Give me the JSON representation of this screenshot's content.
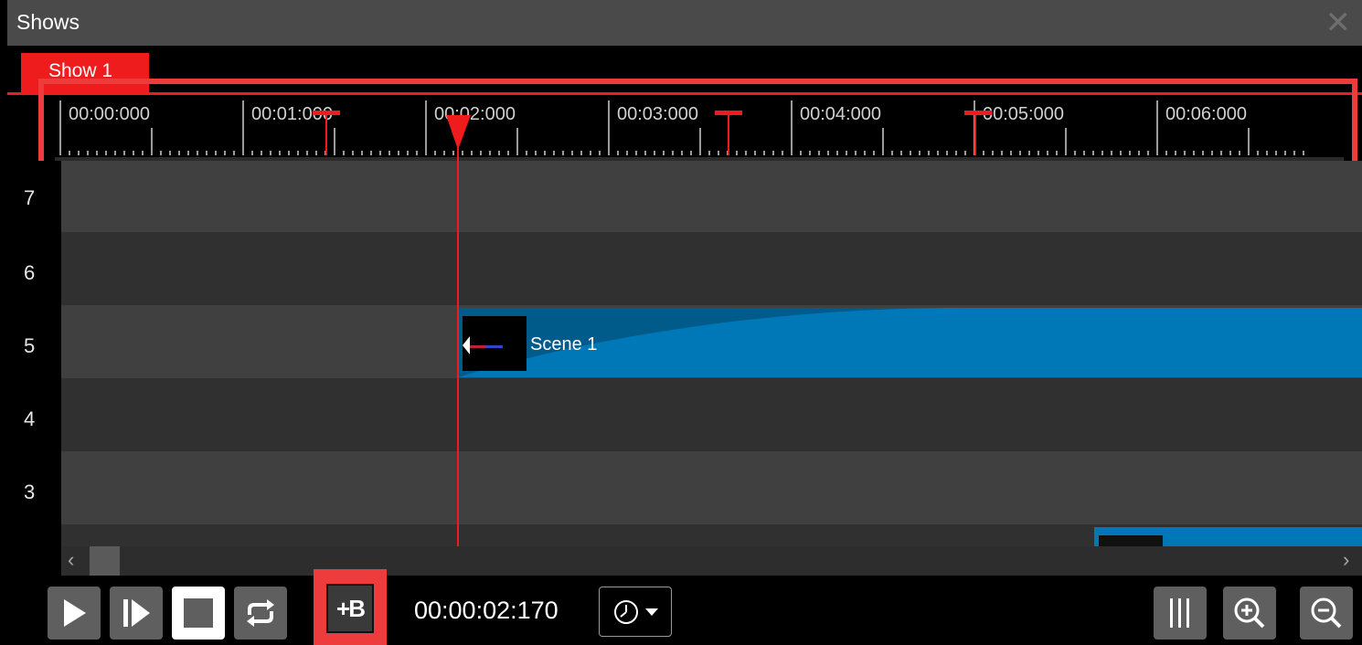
{
  "window": {
    "title": "Shows",
    "close_glyph": "✕"
  },
  "tabs": [
    {
      "label": "Show 1",
      "active": true
    }
  ],
  "ruler": {
    "labels": [
      "00:00:000",
      "00:01:000",
      "00:02:000",
      "00:03:000",
      "00:04:000",
      "00:05:000",
      "00:06:000"
    ]
  },
  "lanes": [
    {
      "label": "7"
    },
    {
      "label": "6"
    },
    {
      "label": "5"
    },
    {
      "label": "4"
    },
    {
      "label": "3"
    }
  ],
  "clips": [
    {
      "name": "Scene 1",
      "lane": "5"
    }
  ],
  "transport": {
    "timecode": "00:00:02:170",
    "bookmark_label": "+B"
  },
  "icons": {
    "play": "play-icon",
    "step": "step-forward-icon",
    "stop": "stop-icon",
    "loop": "loop-icon",
    "clock": "clock-icon",
    "columns": "columns-icon",
    "zoom_in": "zoom-in-icon",
    "zoom_out": "zoom-out-icon"
  },
  "colors": {
    "accent": "#ee1c1c",
    "clip": "#0077b6",
    "highlight": "#ee3b3b"
  }
}
